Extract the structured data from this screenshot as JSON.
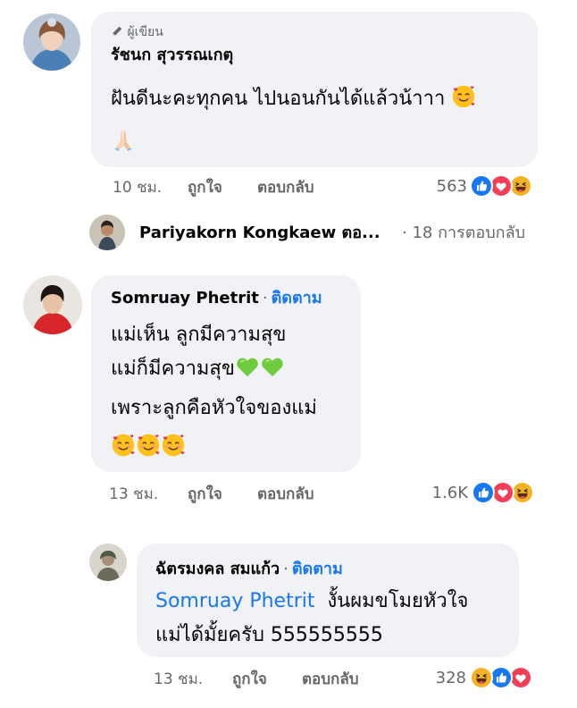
{
  "colors": {
    "bubble": "#f0f2f5",
    "link": "#1877f2",
    "muted": "#65676b",
    "like": "#1877f2",
    "love": "#f33e58",
    "haha": "#f7b125"
  },
  "comment1": {
    "badge_icon": "pen-icon",
    "badge": "ผู้เขียน",
    "author": "รัชนก สุวรรณเกตุ",
    "text_line1": "ฝันดีนะคะทุกคน ไปนอนกันได้แล้วน้าาา",
    "line1_emoji": "smiling-face-with-hearts-emoji",
    "line2_emoji": "folded-hands-emoji",
    "time": "10 ชม.",
    "like_label": "ถูกใจ",
    "reply_label": "ตอบกลับ",
    "reaction_count": "563",
    "reactions": [
      "like-icon",
      "love-icon",
      "haha-icon"
    ]
  },
  "reply_summary": {
    "name": "Pariyakorn Kongkaew ตอ...",
    "count": "· 18 การตอบกลับ"
  },
  "comment2": {
    "author": "Somruay Phetrit",
    "separator": "·",
    "follow": "ติดตาม",
    "lines": [
      "แม่เห็น ลูกมีความสุข",
      "แม่ก็มีความสุข",
      "เพราะลูกคือหัวใจของแม่"
    ],
    "line2_emojis": [
      "green-heart-emoji",
      "green-heart-emoji"
    ],
    "line4_emojis": [
      "smiling-face-with-hearts-emoji",
      "smiling-face-with-hearts-emoji",
      "smiling-face-with-hearts-emoji"
    ],
    "time": "13 ชม.",
    "like_label": "ถูกใจ",
    "reply_label": "ตอบกลับ",
    "reaction_count": "1.6K",
    "reactions": [
      "like-icon",
      "love-icon",
      "haha-icon"
    ]
  },
  "comment3": {
    "author": "ฉัตรมงคล สมแก้ว",
    "separator": "·",
    "follow": "ติดตาม",
    "mention": "Somruay Phetrit",
    "text_line1": "งั้นผมขโมยหัวใจ",
    "text_line2": "แม่ได้มั้ยครับ 555555555",
    "time": "13 ชม.",
    "like_label": "ถูกใจ",
    "reply_label": "ตอบกลับ",
    "reaction_count": "328",
    "reactions": [
      "haha-icon",
      "like-icon",
      "love-icon"
    ]
  }
}
